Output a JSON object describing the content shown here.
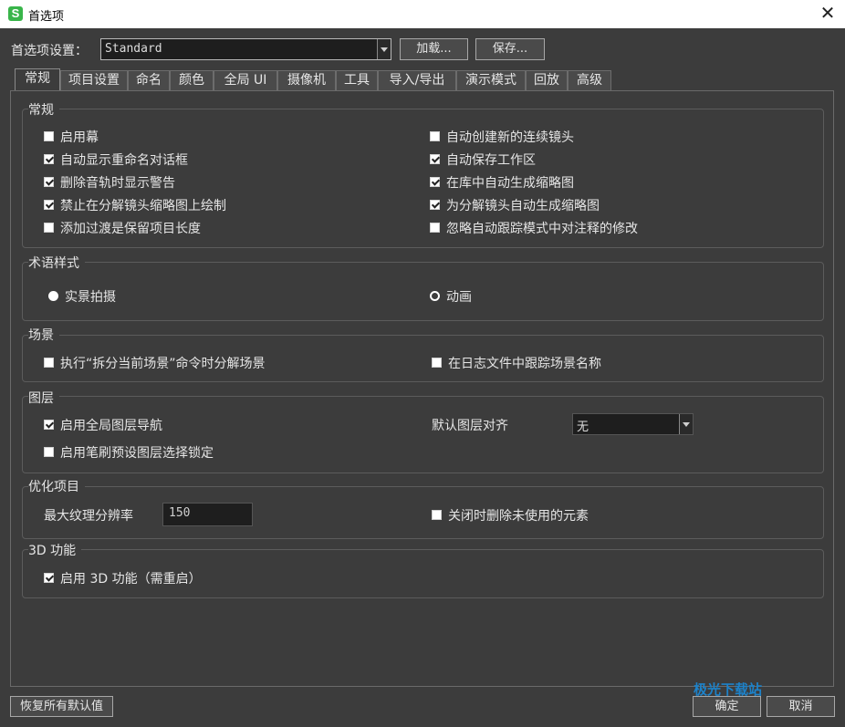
{
  "window": {
    "title": "首选项",
    "app_icon": "S"
  },
  "preset": {
    "label": "首选项设置：",
    "value": "Standard",
    "load_button": "加载...",
    "save_button": "保存..."
  },
  "tabs": [
    "常规",
    "项目设置",
    "命名",
    "颜色",
    "全局 UI",
    "摄像机",
    "工具",
    "导入/导出",
    "演示模式",
    "回放",
    "高级"
  ],
  "active_tab": "常规",
  "general": {
    "title": "常规",
    "left": [
      {
        "label": "启用幕",
        "checked": false
      },
      {
        "label": "自动显示重命名对话框",
        "checked": true
      },
      {
        "label": "删除音轨时显示警告",
        "checked": true
      },
      {
        "label": "禁止在分解镜头缩略图上绘制",
        "checked": true
      },
      {
        "label": "添加过渡是保留项目长度",
        "checked": false
      }
    ],
    "right": [
      {
        "label": "自动创建新的连续镜头",
        "checked": false
      },
      {
        "label": "自动保存工作区",
        "checked": true
      },
      {
        "label": "在库中自动生成缩略图",
        "checked": true
      },
      {
        "label": "为分解镜头自动生成缩略图",
        "checked": true
      },
      {
        "label": "忽略自动跟踪模式中对注释的修改",
        "checked": false
      }
    ]
  },
  "terminology": {
    "title": "术语样式",
    "option_live": {
      "label": "实景拍摄",
      "selected": true
    },
    "option_anim": {
      "label": "动画",
      "selected": false
    }
  },
  "scene": {
    "title": "场景",
    "split": {
      "label": "执行“拆分当前场景”命令时分解场景",
      "checked": false
    },
    "track": {
      "label": "在日志文件中跟踪场景名称",
      "checked": false
    }
  },
  "layers": {
    "title": "图层",
    "global_nav": {
      "label": "启用全局图层导航",
      "checked": true
    },
    "brush_lock": {
      "label": "启用笔刷预设图层选择锁定",
      "checked": false
    },
    "align_label": "默认图层对齐",
    "align_value": "无"
  },
  "optimize": {
    "title": "优化项目",
    "max_res_label": "最大纹理分辨率",
    "max_res_value": "150",
    "remove_unused": {
      "label": "关闭时删除未使用的元素",
      "checked": false
    }
  },
  "three_d": {
    "title": "3D 功能",
    "enable": {
      "label": "启用 3D 功能（需重启）",
      "checked": true
    }
  },
  "footer": {
    "restore_button": "恢复所有默认值",
    "ok_button": "确定",
    "cancel_button": "取消"
  },
  "watermark": "极光下载站"
}
